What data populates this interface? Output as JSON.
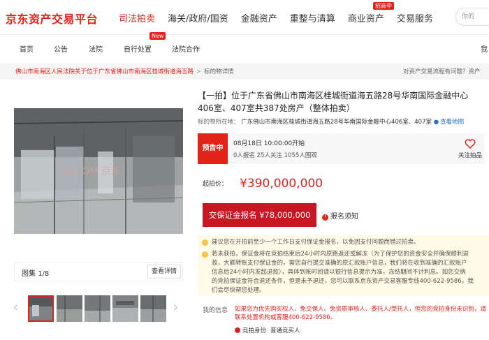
{
  "header": {
    "logo": "京东资产交易平台",
    "nav": [
      "司法拍卖",
      "海关/政府/国资",
      "金融资产",
      "重整与清算",
      "商业资产",
      "交易服务"
    ],
    "nav_active_index": 0,
    "hot_badge": "招商中",
    "search_placeholder": "你的"
  },
  "subnav": {
    "items": [
      "首页",
      "公告",
      "法院",
      "自行处置",
      "法院合作"
    ],
    "new_badge": "New",
    "right_text": "我"
  },
  "breadcrumb": {
    "court": "佛山市南海区人民法院关于位于广东省佛山市南海区桂城街道海五路",
    "sep": ">",
    "current": "标的物详情",
    "help": "对资产交易流程有问题？资产"
  },
  "gallery": {
    "count_label": "图集",
    "count_value": "1/8",
    "detail_button": "查看详情",
    "watermark": "JD.COM 京东",
    "thumbs": 5,
    "selected_thumb": 0
  },
  "listing": {
    "title": "【一拍】位于广东省佛山市南海区桂城街道海五路28号华南国际金融中心406室、407室共387处房产（整体拍卖）",
    "location_label": "标的物所在地：",
    "location": "广东佛山市南海区桂城街道海五路28号华南国际金融中心406室、407室",
    "map_link": "查看地图",
    "status": "预告中",
    "start_time": "08月18日 10:00:00开始",
    "stats": "0人报名  25人关注  1055人围观",
    "follow_label": "关注拍品",
    "price_label": "起拍价：",
    "price": "¥390,000,000",
    "deposit_button": "交保证金报名 ¥78,000,000",
    "notice_link": "报名须知"
  },
  "tips": [
    "建议您在开拍前至少一个工作日支付保证金报名，以免因支付问题而错过拍卖。",
    "若未获拍，保证金将在竞拍结束后24小时内原路返还或解冻（为了保护您的资金安全并确保顺利退",
    "款，大额转账支付保证金的，需您自行提交准确的原汇款账户信息，我们将在收到准确的汇款账户",
    "信息后24小时内发起退款），具体到账时间请以银行信息提示为准，冻结期间不计利息。如您交纳",
    "的竞拍保证金符合退还条件，但是未予退还，您可以联系京东资产交易客服专线400-622-9586。我",
    "们会尽快帮您处理。"
  ],
  "myinfo": {
    "label": "我的信息",
    "lines": [
      "如果您为优先购买权人、免交保人、免资质审核人、委托人/受托人，但您的竞拍身份未识别，请",
      "联系处置机构或客服400-622-9586。"
    ],
    "identity_label": "竞拍身份",
    "identity_value": "普通竞买人"
  },
  "colors": {
    "brand": "#e2231a",
    "button": "#c81623",
    "tip_bg": "#fffbe6",
    "link": "#2a6ebf"
  },
  "icons": [
    "search-icon",
    "heart-plus-icon",
    "info-icon",
    "location-pin-icon",
    "chevron-left-icon",
    "chevron-right-icon",
    "user-identity-icon"
  ]
}
